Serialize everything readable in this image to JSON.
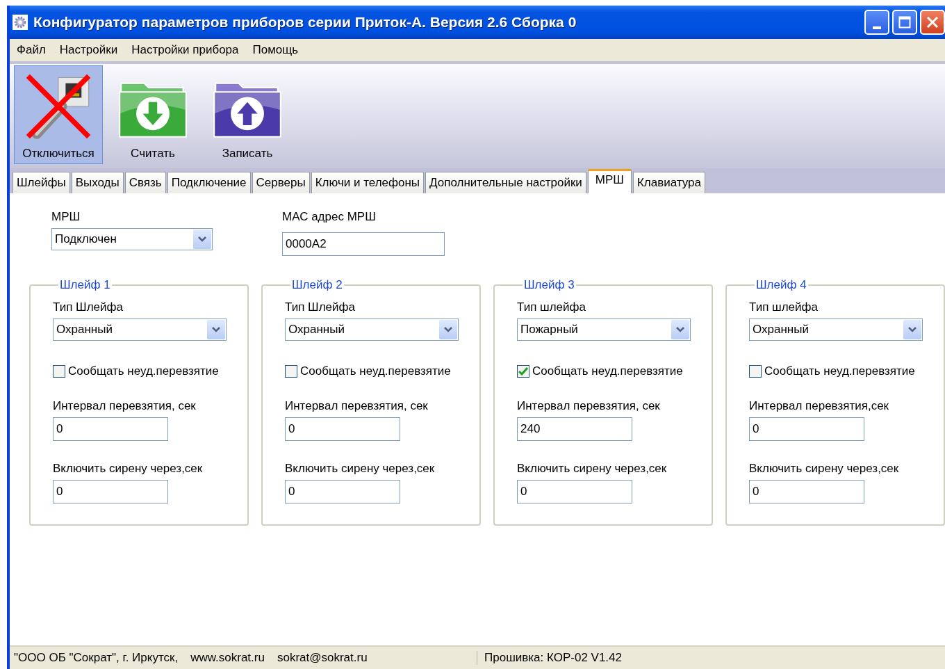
{
  "window": {
    "title": "Конфигуратор параметров приборов серии Приток-А. Версия 2.6 Сборка 0"
  },
  "menu": [
    "Файл",
    "Настройки",
    "Настройки прибора",
    "Помощь"
  ],
  "toolbar": [
    {
      "label": "Отключиться",
      "kind": "disconnect",
      "selected": true
    },
    {
      "label": "Считать",
      "kind": "read",
      "selected": false
    },
    {
      "label": "Записать",
      "kind": "write",
      "selected": false
    }
  ],
  "tabs": [
    {
      "label": "Шлейфы",
      "selected": false
    },
    {
      "label": "Выходы",
      "selected": false
    },
    {
      "label": "Связь",
      "selected": false
    },
    {
      "label": "Подключение",
      "selected": false
    },
    {
      "label": "Серверы",
      "selected": false
    },
    {
      "label": "Ключи и телефоны",
      "selected": false
    },
    {
      "label": "Дополнительные настройки",
      "selected": false
    },
    {
      "label": "МРШ",
      "selected": true
    },
    {
      "label": "Клавиатура",
      "selected": false
    }
  ],
  "mrsh": {
    "label": "МРШ",
    "value": "Подключен"
  },
  "mac": {
    "label": "МАС адрес МРШ",
    "value": "0000А2"
  },
  "loops": [
    {
      "title": "Шлейф 1",
      "type_label": "Тип Шлейфа",
      "type_value": "Охранный",
      "report_label": "Сообщать неуд.перевзятие",
      "checked": false,
      "interval_label": "Интервал перевзятия, сек",
      "interval": "0",
      "siren_label": "Включить сирену через,сек",
      "siren": "0"
    },
    {
      "title": "Шлейф 2",
      "type_label": "Тип Шлейфа",
      "type_value": "Охранный",
      "report_label": "Сообщать неуд.перевзятие",
      "checked": false,
      "interval_label": "Интервал перевзятия, сек",
      "interval": "0",
      "siren_label": "Включить сирену через,сек",
      "siren": "0"
    },
    {
      "title": "Шлейф 3",
      "type_label": "Тип шлейфа",
      "type_value": "Пожарный",
      "report_label": "Сообщать неуд.перевзятие",
      "checked": true,
      "interval_label": "Интервал перевзятия, сек",
      "interval": "240",
      "siren_label": "Включить сирену через,сек",
      "siren": "0"
    },
    {
      "title": "Шлейф 4",
      "type_label": "Тип шлейфа",
      "type_value": "Охранный",
      "report_label": "Сообщать неуд.перевзятие",
      "checked": false,
      "interval_label": "Интервал перевзятия,сек",
      "interval": "0",
      "siren_label": "Включить сирену через,сек",
      "siren": "0"
    }
  ],
  "status_bar": {
    "company": "\"ООО ОБ \"Сократ\", г. Иркутск,",
    "site": "www.sokrat.ru",
    "email": "sokrat@sokrat.ru",
    "firmware": "Прошивка: КОР-02 V1.42"
  }
}
